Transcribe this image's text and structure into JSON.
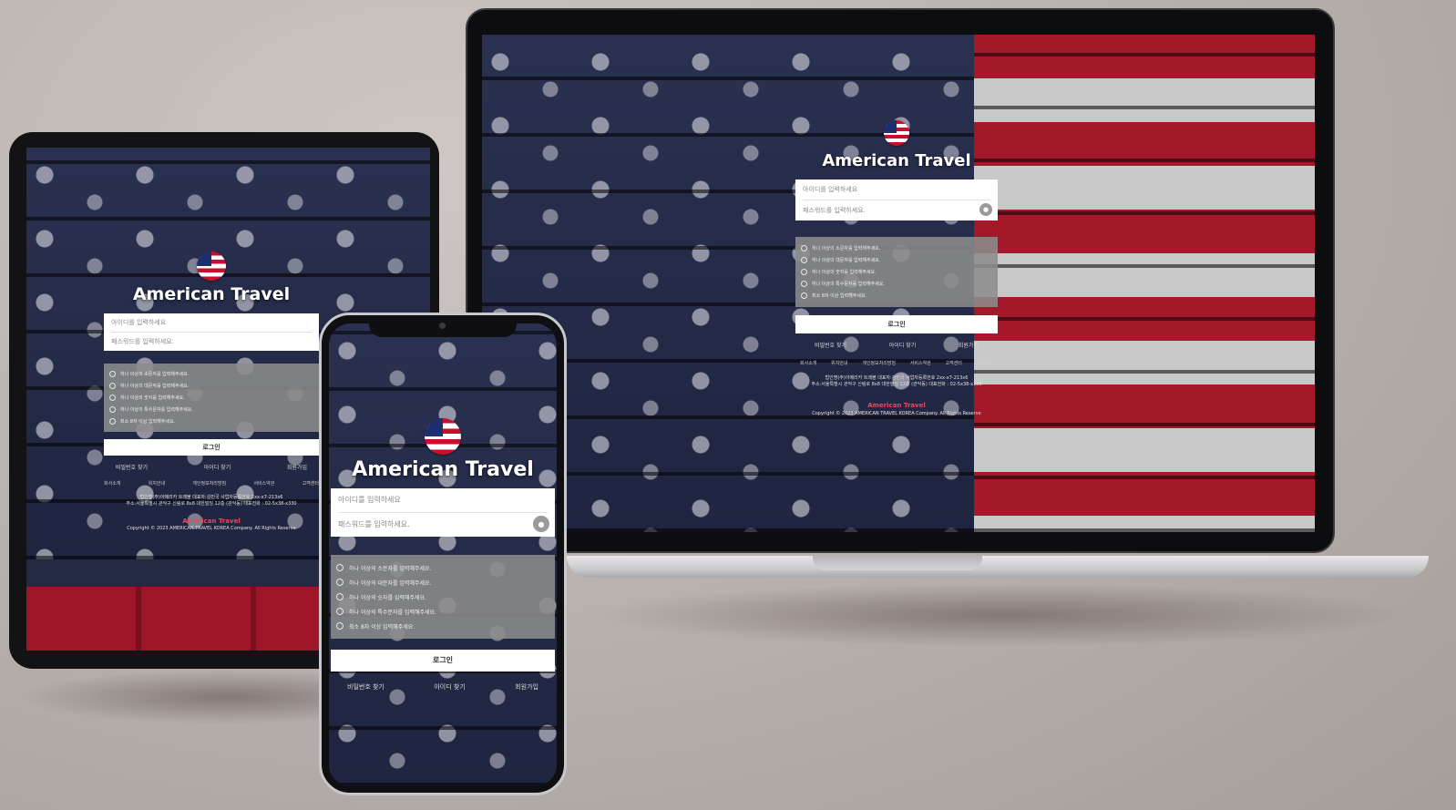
{
  "brand": {
    "title": "American Travel",
    "logo_icon": "us-flag-icon"
  },
  "login": {
    "id_placeholder": "아이디를 입력하세요",
    "pw_placeholder": "패스워드를 입력하세요.",
    "pw_toggle_icon": "eye-icon",
    "rules": [
      "하나 이상의 소문자를 입력해주세요.",
      "하나 이상의 대문자를 입력해주세요.",
      "하나 이상의 숫자를 입력해주세요.",
      "하나 이상의 특수문자를 입력해주세요.",
      "최소 8자 이상 입력해주세요."
    ],
    "submit_label": "로그인"
  },
  "links": {
    "find_password": "비밀번호 찾기",
    "find_id": "아이디 찾기",
    "signup": "회원가입"
  },
  "footer": {
    "nav": [
      "회사소개",
      "위치안내",
      "개인정보처리방침",
      "서비스약관",
      "고객센터",
      "사이트맵"
    ],
    "company_line": "법인명(주)아메리카 트래블 대표자:김민국 사업자등록번호 2xx-x7-213x6",
    "address_line": "주소:서울특별시 관악구 신림로 8x8 대한빌딩 12층 (관악동) 대표전화 : 02-5x38-x330",
    "brand": "American Travel",
    "copyright": "Copyright © 2023 AMERICAN TRAVEL KOREA Company. All Rights Reserve"
  },
  "colors": {
    "background": "#b7afab",
    "flag_blue": "#1c2f6e",
    "flag_red": "#c8102e",
    "footer_brand": "#e34b5f"
  }
}
